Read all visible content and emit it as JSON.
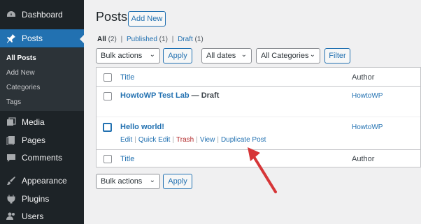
{
  "sidebar": {
    "items": [
      {
        "label": "Dashboard",
        "icon": "dashboard-icon"
      },
      {
        "label": "Posts",
        "icon": "pin-icon"
      },
      {
        "label": "Media",
        "icon": "media-icon"
      },
      {
        "label": "Pages",
        "icon": "pages-icon"
      },
      {
        "label": "Comments",
        "icon": "comments-icon"
      },
      {
        "label": "Appearance",
        "icon": "brush-icon"
      },
      {
        "label": "Plugins",
        "icon": "plugins-icon"
      },
      {
        "label": "Users",
        "icon": "users-icon"
      }
    ],
    "submenu": [
      "All Posts",
      "Add New",
      "Categories",
      "Tags"
    ]
  },
  "main": {
    "title": "Posts",
    "add_new": "Add New",
    "filters": {
      "all_label": "All",
      "all_count": "(2)",
      "published_label": "Published",
      "published_count": "(1)",
      "draft_label": "Draft",
      "draft_count": "(1)",
      "sep": "|"
    },
    "bulk_actions": "Bulk actions",
    "apply": "Apply",
    "all_dates": "All dates",
    "all_categories": "All Categories",
    "filter": "Filter",
    "table": {
      "col_title": "Title",
      "col_author": "Author",
      "rows": [
        {
          "title": "HowtoWP Test Lab",
          "state": "— Draft",
          "author": "HowtoWP"
        },
        {
          "title": "Hello world!",
          "state": "",
          "author": "HowtoWP"
        }
      ],
      "row_actions": [
        "Edit",
        "Quick Edit",
        "Trash",
        "View",
        "Duplicate Post"
      ],
      "action_sep": "|"
    }
  },
  "colors": {
    "sidebar_bg": "#1d2327",
    "accent": "#2271b1",
    "arrow": "#d63638"
  }
}
